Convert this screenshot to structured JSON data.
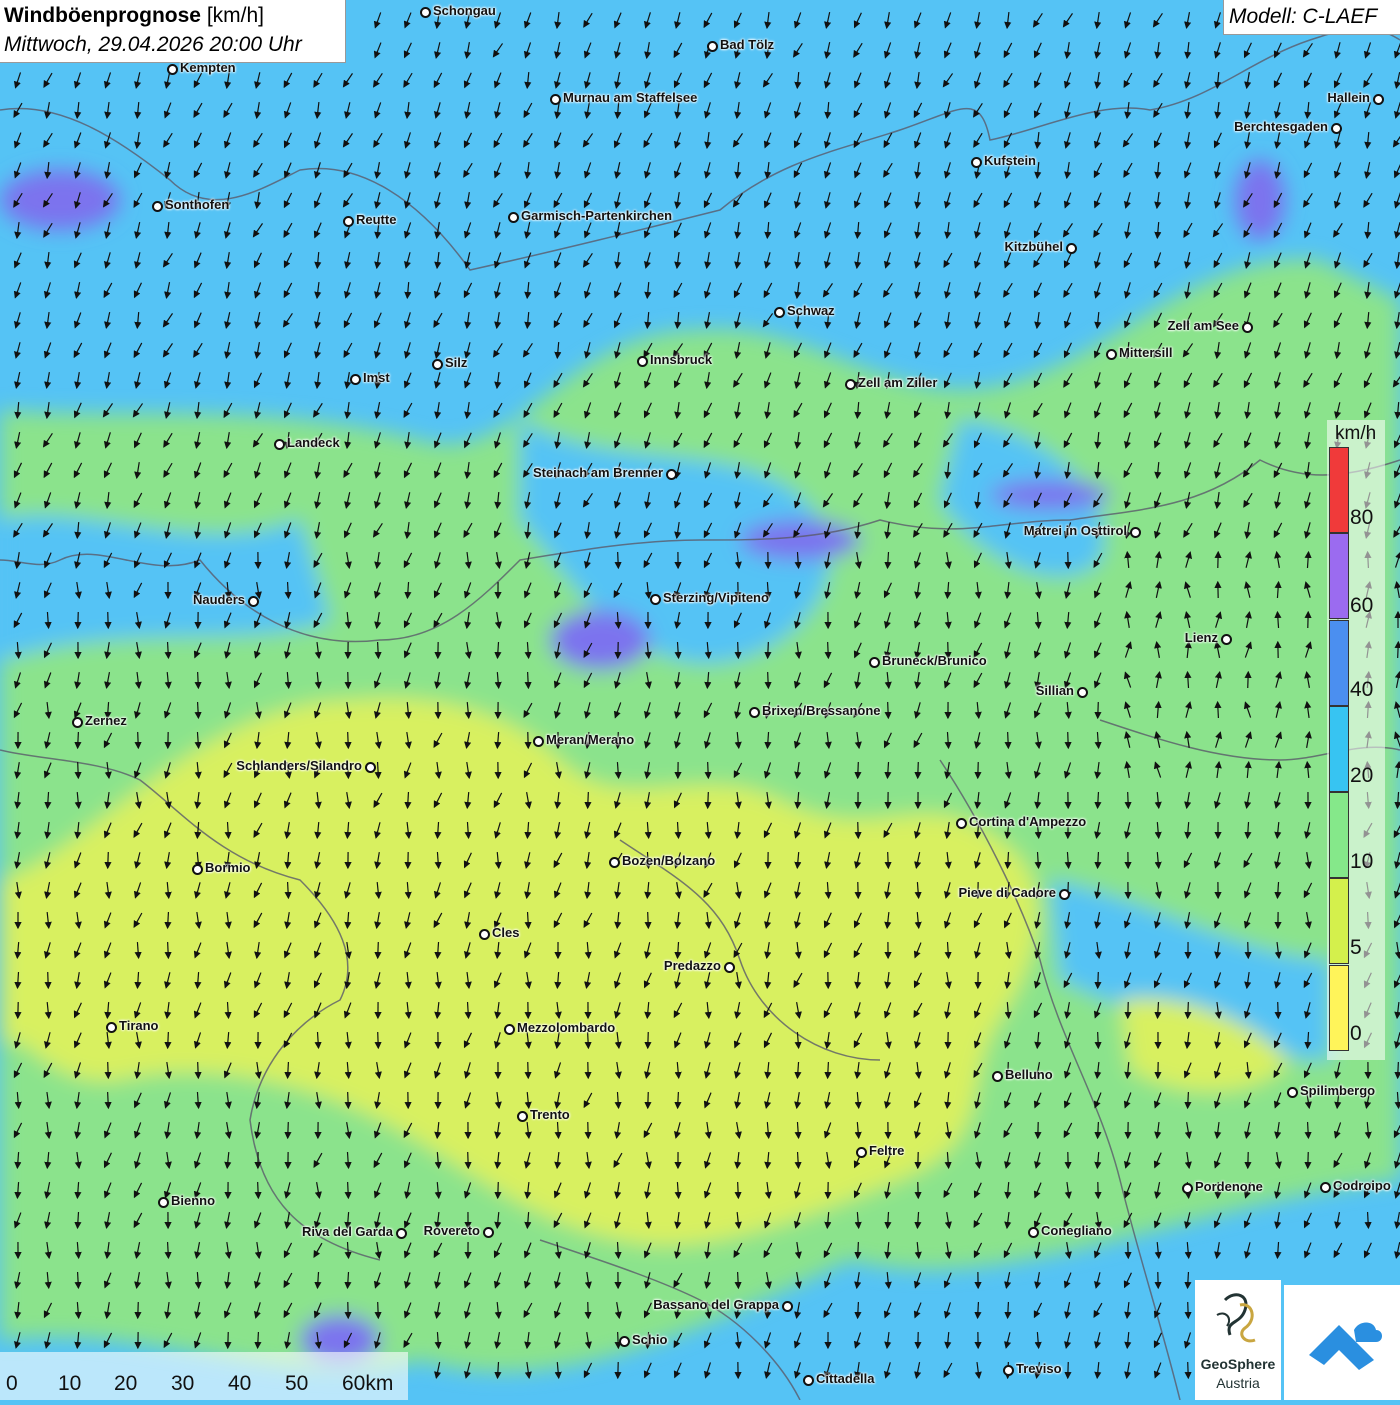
{
  "title": {
    "main": "Windböenprognose",
    "unit": "[km/h]"
  },
  "subtitle": "Mittwoch, 29.04.2026 20:00 Uhr",
  "model_label": "Modell: C-LAEF",
  "legend": {
    "unit": "km/h",
    "ticks": [
      "0",
      "5",
      "10",
      "20",
      "40",
      "60",
      "80"
    ],
    "colors": [
      "#fff45a",
      "#d4f04c",
      "#85e88a",
      "#37c4f2",
      "#4b8ff0",
      "#9b6bf0",
      "#f03a3a"
    ]
  },
  "scalebar": {
    "labels": [
      "0",
      "10",
      "20",
      "30",
      "40",
      "50",
      "60km"
    ]
  },
  "branding": {
    "name": "GeoSphere",
    "sub": "Austria"
  },
  "cities": [
    {
      "name": "Schongau"
    },
    {
      "name": "Bad Tölz"
    },
    {
      "name": "Kempten"
    },
    {
      "name": "Murnau am Staffelsee"
    },
    {
      "name": "Hallein"
    },
    {
      "name": "Berchtesgaden"
    },
    {
      "name": "Kufstein"
    },
    {
      "name": "Sonthofen"
    },
    {
      "name": "Reutte"
    },
    {
      "name": "Garmisch-Partenkirchen"
    },
    {
      "name": "Kitzbühel"
    },
    {
      "name": "Schwaz"
    },
    {
      "name": "Zell am See"
    },
    {
      "name": "Mittersill"
    },
    {
      "name": "Imst"
    },
    {
      "name": "Silz"
    },
    {
      "name": "Innsbruck"
    },
    {
      "name": "Zell am Ziller"
    },
    {
      "name": "Landeck"
    },
    {
      "name": "Steinach am Brenner"
    },
    {
      "name": "Matrei in Osttirol"
    },
    {
      "name": "Nauders"
    },
    {
      "name": "Sterzing/Vipiteno"
    },
    {
      "name": "Lienz"
    },
    {
      "name": "Bruneck/Brunico"
    },
    {
      "name": "Sillian"
    },
    {
      "name": "Zernez"
    },
    {
      "name": "Brixen/Bressanone"
    },
    {
      "name": "Meran/Merano"
    },
    {
      "name": "Schlanders/Silandro"
    },
    {
      "name": "Cortina d'Ampezzo"
    },
    {
      "name": "Bormio"
    },
    {
      "name": "Bozen/Bolzano"
    },
    {
      "name": "Pieve di Cadore"
    },
    {
      "name": "Cles"
    },
    {
      "name": "Predazzo"
    },
    {
      "name": "Tirano"
    },
    {
      "name": "Mezzolombardo"
    },
    {
      "name": "Belluno"
    },
    {
      "name": "Spilimbergo"
    },
    {
      "name": "Trento"
    },
    {
      "name": "Feltre"
    },
    {
      "name": "Bienno"
    },
    {
      "name": "Pordenone"
    },
    {
      "name": "Codroipo"
    },
    {
      "name": "Riva del Garda"
    },
    {
      "name": "Rovereto"
    },
    {
      "name": "Conegliano"
    },
    {
      "name": "Bassano del Grappa"
    },
    {
      "name": "Schio"
    },
    {
      "name": "Treviso"
    },
    {
      "name": "Cittadella"
    }
  ]
}
